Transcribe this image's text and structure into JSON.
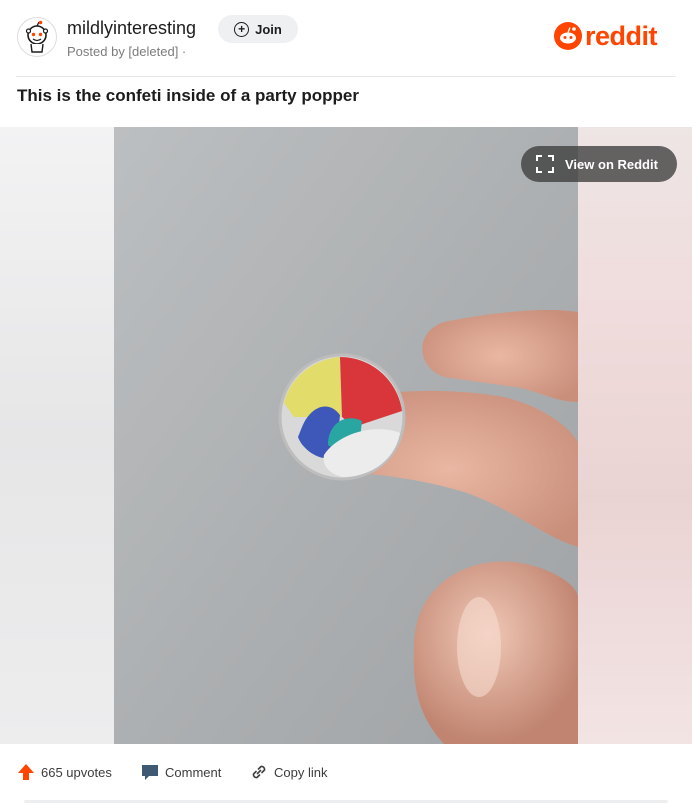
{
  "post": {
    "subreddit": "mildlyinteresting",
    "posted_by": "Posted by [deleted] ·",
    "join_label": "Join",
    "title": "This is the confeti inside of a party popper"
  },
  "brand": {
    "name": "reddit",
    "color": "#ff4500"
  },
  "media": {
    "view_label": "View on Reddit",
    "expand_icon": "expand-icon"
  },
  "actions": {
    "upvotes": "665 upvotes",
    "comment": "Comment",
    "copy_link": "Copy link"
  },
  "colors": {
    "accent": "#ff4500",
    "text": "#1c1c1c",
    "muted": "#7c7c7c",
    "comment_icon": "#3d5a72"
  }
}
